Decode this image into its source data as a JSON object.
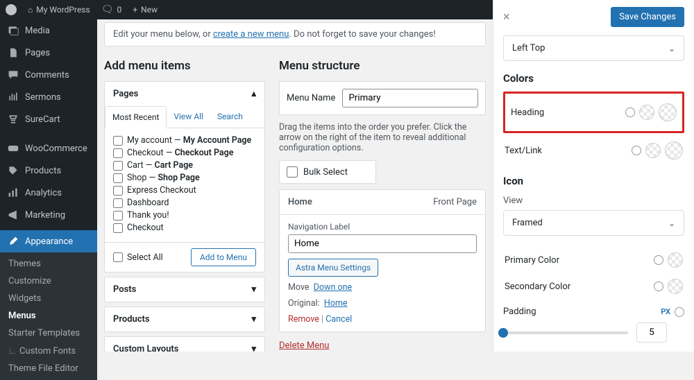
{
  "adminbar": {
    "site": "My WordPress",
    "comments": "0",
    "new": "New"
  },
  "sidebar": {
    "items": [
      {
        "label": "Media"
      },
      {
        "label": "Pages"
      },
      {
        "label": "Comments"
      },
      {
        "label": "Sermons"
      },
      {
        "label": "SureCart"
      },
      {
        "label": "WooCommerce"
      },
      {
        "label": "Products"
      },
      {
        "label": "Analytics"
      },
      {
        "label": "Marketing"
      },
      {
        "label": "Appearance"
      }
    ],
    "submenu": [
      {
        "label": "Themes"
      },
      {
        "label": "Customize"
      },
      {
        "label": "Widgets"
      },
      {
        "label": "Menus"
      },
      {
        "label": "Starter Templates"
      },
      {
        "label": "Custom Fonts"
      },
      {
        "label": "Theme File Editor"
      }
    ]
  },
  "main": {
    "notice_pre": "Edit your menu below, or ",
    "notice_link": "create a new menu",
    "notice_post": ". Do not forget to save your changes!",
    "add_heading": "Add menu items",
    "structure_heading": "Menu structure",
    "pages_title": "Pages",
    "tabs": {
      "most": "Most Recent",
      "view": "View All",
      "search": "Search"
    },
    "page_items": [
      {
        "pre": "My account — ",
        "bold": "My Account Page"
      },
      {
        "pre": "Checkout — ",
        "bold": "Checkout Page"
      },
      {
        "pre": "Cart — ",
        "bold": "Cart Page"
      },
      {
        "pre": "Shop — ",
        "bold": "Shop Page"
      },
      {
        "pre": "Express Checkout",
        "bold": ""
      },
      {
        "pre": "Dashboard",
        "bold": ""
      },
      {
        "pre": "Thank you!",
        "bold": ""
      },
      {
        "pre": "Checkout",
        "bold": ""
      }
    ],
    "select_all": "Select All",
    "add_to_menu": "Add to Menu",
    "posts": "Posts",
    "products": "Products",
    "custom_layouts": "Custom Layouts",
    "menu_name_label": "Menu Name",
    "menu_name": "Primary",
    "drag_text": "Drag the items into the order you prefer. Click the arrow on the right of the item to reveal additional configuration options.",
    "bulk_select": "Bulk Select",
    "item": {
      "title": "Home",
      "type": "Front Page",
      "nav_label": "Navigation Label",
      "val": "Home",
      "astra": "Astra Menu Settings",
      "move": "Move",
      "down": "Down one",
      "original": "Original:",
      "orig_link": "Home",
      "remove": "Remove",
      "cancel": "Cancel"
    },
    "delete": "Delete Menu"
  },
  "panel": {
    "save": "Save Changes",
    "align": "Left Top",
    "colors_h": "Colors",
    "heading_row": "Heading",
    "text_row": "Text/Link",
    "icon_h": "Icon",
    "view_label": "View",
    "view_val": "Framed",
    "primary": "Primary Color",
    "secondary": "Secondary Color",
    "padding": "Padding",
    "unit": "PX",
    "pad_val": "5"
  }
}
